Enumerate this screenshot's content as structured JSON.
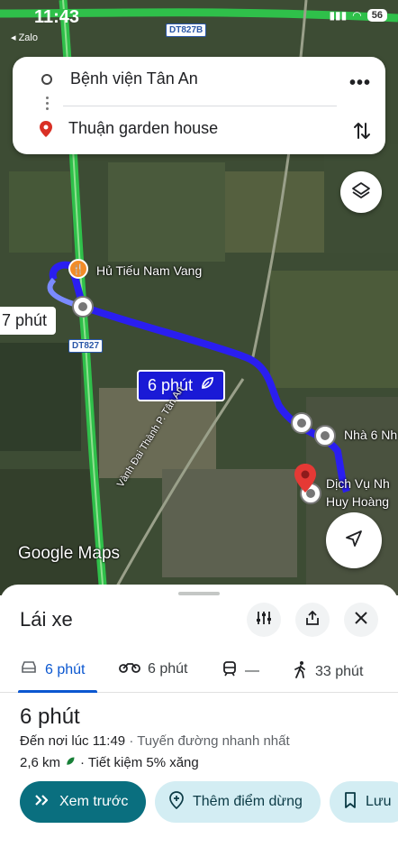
{
  "status_bar": {
    "time": "11:43",
    "back_app": "Zalo",
    "road_badge": "DT827B",
    "network_badge": "56"
  },
  "search": {
    "origin": "Bệnh viện Tân An",
    "destination": "Thuận garden house",
    "more_icon": "more-horiz-icon",
    "swap_icon": "swap-vert-icon"
  },
  "map": {
    "poi_restaurant": "Hủ Tiếu Nam Vang",
    "alt_route_time": "7 phút",
    "main_route_time": "6 phút",
    "road_label": "DT827",
    "road_name": "Vành Đai Thành P. Tân An",
    "poi_house": "Nhà 6 Nh",
    "poi_service_line1": "Dịch Vụ Nh",
    "poi_service_line2": "Huy Hoàng",
    "watermark": "Google Maps",
    "colors": {
      "route": "#2a1ef0",
      "highway": "#2fc04a",
      "pin": "#e53935"
    }
  },
  "sheet": {
    "title": "Lái xe",
    "tabs": [
      {
        "mode": "car",
        "label": "6 phút"
      },
      {
        "mode": "motorbike",
        "label": "6 phút"
      },
      {
        "mode": "transit",
        "label": "—"
      },
      {
        "mode": "walk",
        "label": "33 phút"
      }
    ],
    "eta": "6 phút",
    "arrival": "Đến nơi lúc 11:49",
    "route_desc": "· Tuyến đường nhanh nhất",
    "distance": "2,6 km",
    "eco": "· Tiết kiệm 5% xăng",
    "buttons": {
      "preview": "Xem trước",
      "add_stop": "Thêm điểm dừng",
      "save": "Lưu"
    }
  }
}
